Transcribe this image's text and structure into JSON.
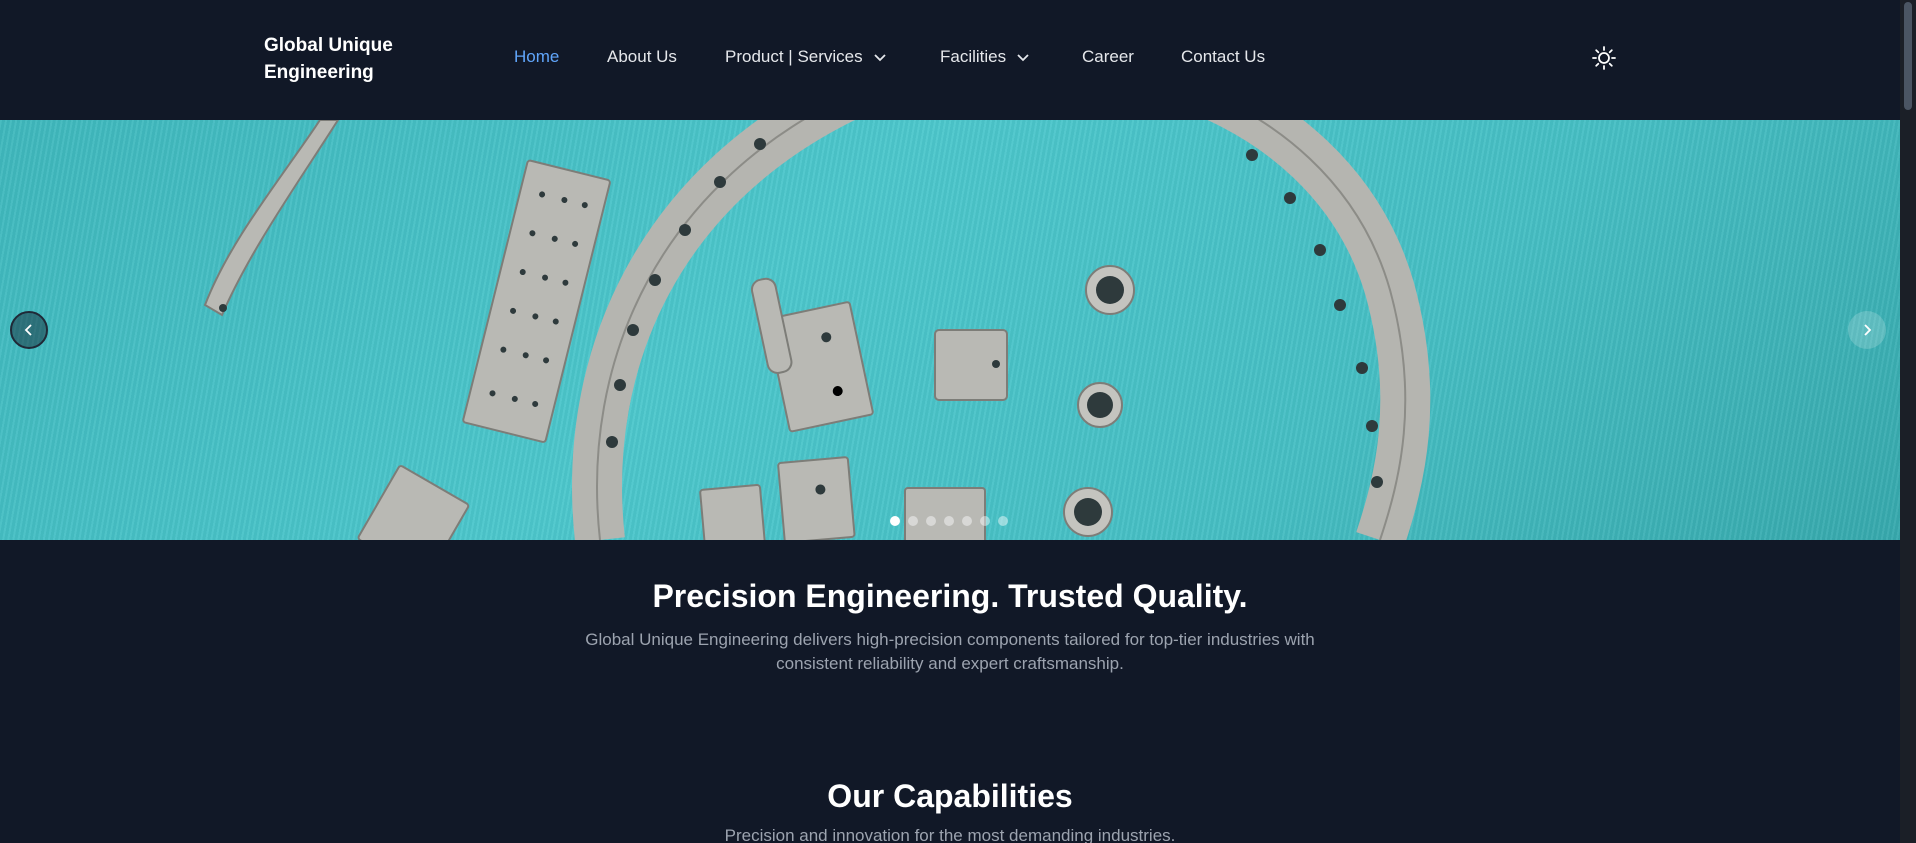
{
  "header": {
    "logo_line1": "Global Unique",
    "logo_line2": "Engineering",
    "nav": [
      {
        "label": "Home",
        "active": true
      },
      {
        "label": "About Us"
      },
      {
        "label": "Product | Services",
        "dropdown": true
      },
      {
        "label": "Facilities",
        "dropdown": true
      },
      {
        "label": "Career"
      },
      {
        "label": "Contact Us"
      }
    ],
    "theme_toggle_icon": "sun-icon"
  },
  "carousel": {
    "prev_icon": "chevron-left-icon",
    "next_icon": "chevron-right-icon",
    "slide_count": 7,
    "active_slide": 1
  },
  "hero_text": {
    "headline": "Precision Engineering. Trusted Quality.",
    "description": "Global Unique Engineering delivers high-precision components tailored for top-tier industries with consistent reliability and expert craftsmanship."
  },
  "capabilities": {
    "title": "Our Capabilities",
    "subtitle": "Precision and innovation for the most demanding industries."
  },
  "colors": {
    "background": "#111827",
    "accent": "#60a5fa",
    "hero_teal": "#46bfc4"
  }
}
